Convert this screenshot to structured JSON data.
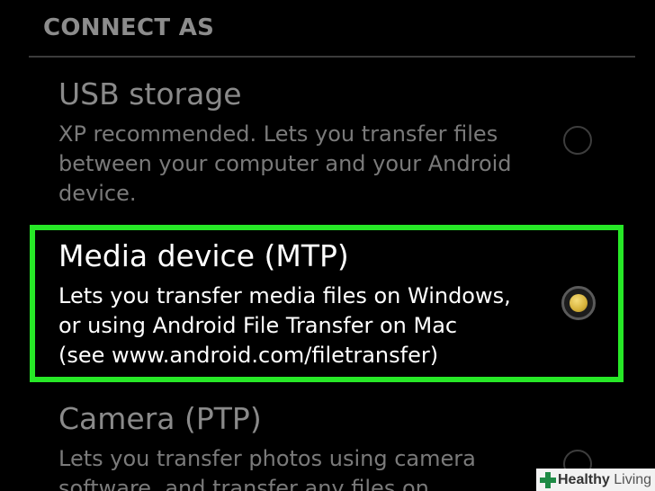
{
  "section": {
    "header": "CONNECT AS"
  },
  "options": [
    {
      "title": "USB storage",
      "description": "XP recommended. Lets you transfer files\nbetween your computer and your Android\ndevice.",
      "selected": false
    },
    {
      "title": "Media device (MTP)",
      "description": "Lets you transfer media files on Windows,\nor using Android File Transfer on Mac\n(see www.android.com/filetransfer)",
      "selected": true
    },
    {
      "title": "Camera (PTP)",
      "description": "Lets you transfer photos using camera\nsoftware, and transfer any files on",
      "selected": false
    }
  ],
  "highlight_color": "#27e827",
  "selected_radio_color": "#d6b23a",
  "watermark": {
    "bold": "Healthy",
    "light": " Living",
    "icon": "plus-icon",
    "icon_color": "#1e8a45"
  }
}
